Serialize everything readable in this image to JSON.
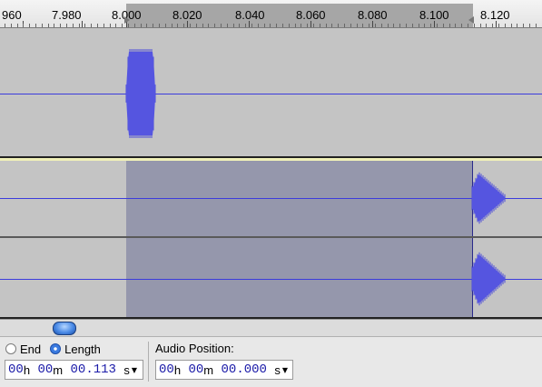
{
  "ruler": {
    "ticks": [
      {
        "id": "t0",
        "label": "960"
      },
      {
        "id": "t1",
        "label": "7.980"
      },
      {
        "id": "t2",
        "label": "8.000"
      },
      {
        "id": "t3",
        "label": "8.020"
      },
      {
        "id": "t4",
        "label": "8.040"
      },
      {
        "id": "t5",
        "label": "8.060"
      },
      {
        "id": "t6",
        "label": "8.080"
      },
      {
        "id": "t7",
        "label": "8.100"
      },
      {
        "id": "t8",
        "label": "8.120"
      }
    ]
  },
  "tracks": [
    {
      "id": "track-1",
      "name": "track-1-waveform"
    },
    {
      "id": "track-2-left",
      "name": "track-2-left-channel"
    },
    {
      "id": "track-2-right",
      "name": "track-2-right-channel"
    }
  ],
  "selection_toolbar": {
    "end_label": "End",
    "length_label": "Length",
    "selected_mode": "Length",
    "selection_time": {
      "hours": "00",
      "h_unit": "h",
      "minutes": "00",
      "m_unit": "m",
      "seconds": "00.113",
      "s_unit": "s"
    },
    "audio_position_label": "Audio Position:",
    "audio_position_time": {
      "hours": "00",
      "h_unit": "h",
      "minutes": "00",
      "m_unit": "m",
      "seconds": "00.000",
      "s_unit": "s"
    }
  },
  "colors": {
    "waveform": "#5f5fe6",
    "selection": "#9597ac",
    "track_bg": "#c4c4c4",
    "time_digits": "#1a1aa8"
  },
  "icons": {
    "scroll_thumb": "scroll-thumb-icon",
    "dropdown": "chevron-down-icon"
  }
}
